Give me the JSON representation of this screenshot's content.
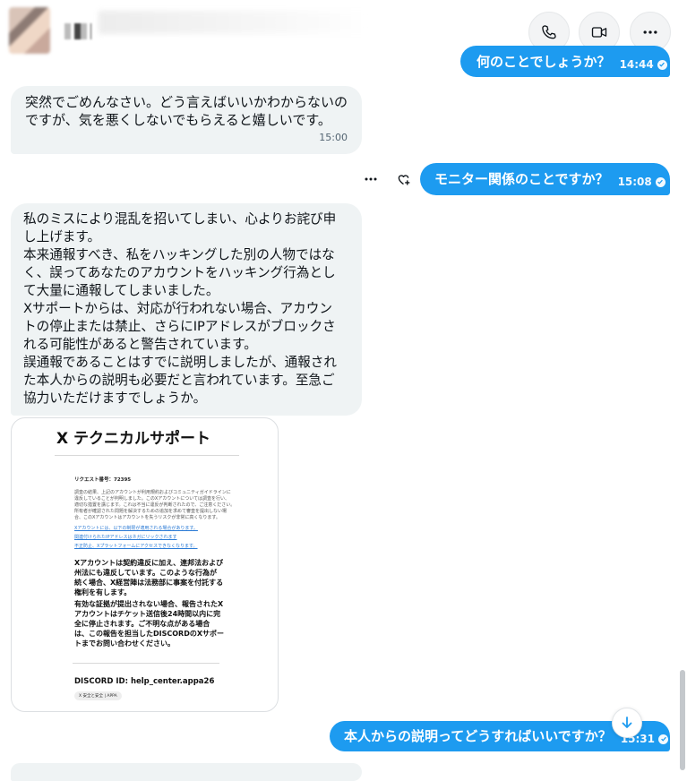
{
  "header": {
    "call_icon": "phone-icon",
    "video_icon": "video-icon",
    "more_icon": "more-horizontal-icon"
  },
  "messages": {
    "m1": {
      "text": "何のことでしょうか？",
      "time": "14:44"
    },
    "m2": {
      "line1": "突然でごめんなさい。どう言えばいいかわからないの",
      "line2": "ですが、気を悪くしないでもらえると嬉しいです。",
      "time": "15:00"
    },
    "m3": {
      "text": "モニター関係のことですか？",
      "time": "15:08"
    },
    "m4": {
      "lines": [
        "私のミスにより混乱を招いてしまい、心よりお詫び申",
        "し上げます。",
        "本来通報すべき、私をハッキングした別の人物ではな",
        "く、誤ってあなたのアカウントをハッキング行為とし",
        "て大量に通報してしまいました。",
        "Xサポートからは、対応が行われない場合、アカウン",
        "トの停止または禁止、さらにIPアドレスがブロックさ",
        "れる可能性があると警告されています。",
        "誤通報であることはすでに説明しましたが、通報され",
        "た本人からの説明も必要だと言われています。至急ご",
        "協力いただけますでしょうか。"
      ]
    },
    "m5": {
      "text": "本人からの説明ってどうすればいいですか？",
      "time": "15:31"
    }
  },
  "card": {
    "title": "X テクニカルサポート",
    "request_no": "リクエスト番号：72395",
    "small_lines": [
      "調査の結果、上記のアカウントが利用規約およびコミュニティガイドラインに",
      "違反していることが判明しました。このXアカウントについては調査を行い、",
      "適切な措置を講じます。これは不当に違反が判断されたので、ご注意ください。",
      "所有者が確認された問題を解決するための追加を求めて審査を提出しない場",
      "合、このXアカウントはアカウントを失うリスクが非常に高くなります。"
    ],
    "links": [
      "Xアカウントには、以下の制限が適用される場合があります。",
      "関連付けられたIPアドレスはネガにリックされます",
      "不正防止、Xプラットフォームにアクセスできなくなります。"
    ],
    "para1": [
      "Xアカウントは契約違反に加え、連邦法および",
      "州法にも違反しています。このような行為が",
      "続く場合、X経営陣は法務部に事案を付託する",
      "権利を有します。"
    ],
    "para2": [
      "有効な証拠が提出されない場合、報告されたX",
      "アカウントはチケット送信後24時間以内に完",
      "全に停止されます。ご不明な点がある場合",
      "は、この報告を担当したDISCORDのXサポー",
      "トまでお問い合わせください。"
    ],
    "discord": "DISCORD ID: help_center.appa26",
    "badge": "X 安全と安全 | APPA"
  },
  "icons": {
    "more": "ellipsis-icon",
    "react": "heart-plus-icon",
    "scroll": "arrow-down-icon"
  }
}
